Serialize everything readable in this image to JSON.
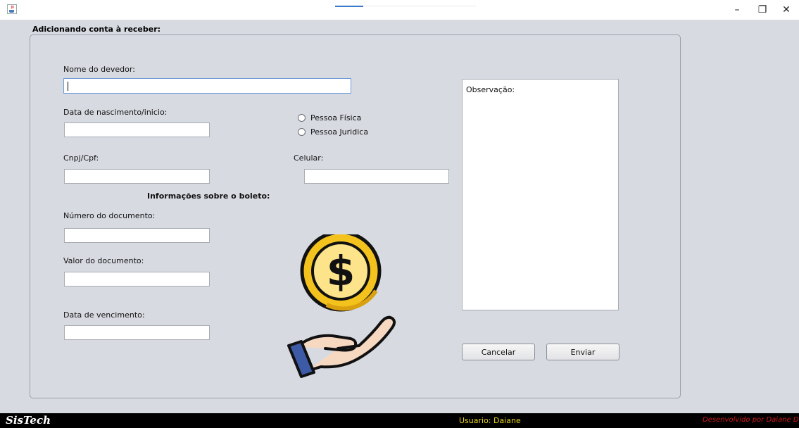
{
  "window": {
    "minimize_glyph": "–",
    "restore_glyph": "❐",
    "close_glyph": "✕"
  },
  "form": {
    "heading": "Adicionando conta à receber:",
    "nome_label": "Nome do devedor:",
    "nome_value": "",
    "nascimento_label": "Data de nascimento/inicio:",
    "nascimento_value": "",
    "pessoa_fisica": "Pessoa Física",
    "pessoa_juridica": "Pessoa Juridica",
    "cnpj_label": "Cnpj/Cpf:",
    "cnpj_value": "",
    "celular_label": "Celular:",
    "celular_value": "",
    "boleto_heading": "Informações sobre o boleto:",
    "numero_label": "Número do documento:",
    "numero_value": "",
    "valor_label": "Valor do documento:",
    "valor_value": "",
    "vencimento_label": "Data de vencimento:",
    "vencimento_value": "",
    "observacao_label": "Observação:",
    "cancelar": "Cancelar",
    "enviar": "Enviar"
  },
  "status": {
    "brand": "SisTech",
    "user": "Usuario: Daiane",
    "developer": "Desenvolvido por Daiane Desti"
  },
  "icons": {
    "app": "java-cup-icon",
    "illustration": "hand-holding-dollar-coin-icon"
  },
  "colors": {
    "background": "#d7dae1",
    "status_bar": "#000000",
    "user_text": "#e8d21e",
    "developer_text": "#d01818",
    "coin_fill": "#fde48a",
    "coin_rim": "#f3c21d"
  }
}
